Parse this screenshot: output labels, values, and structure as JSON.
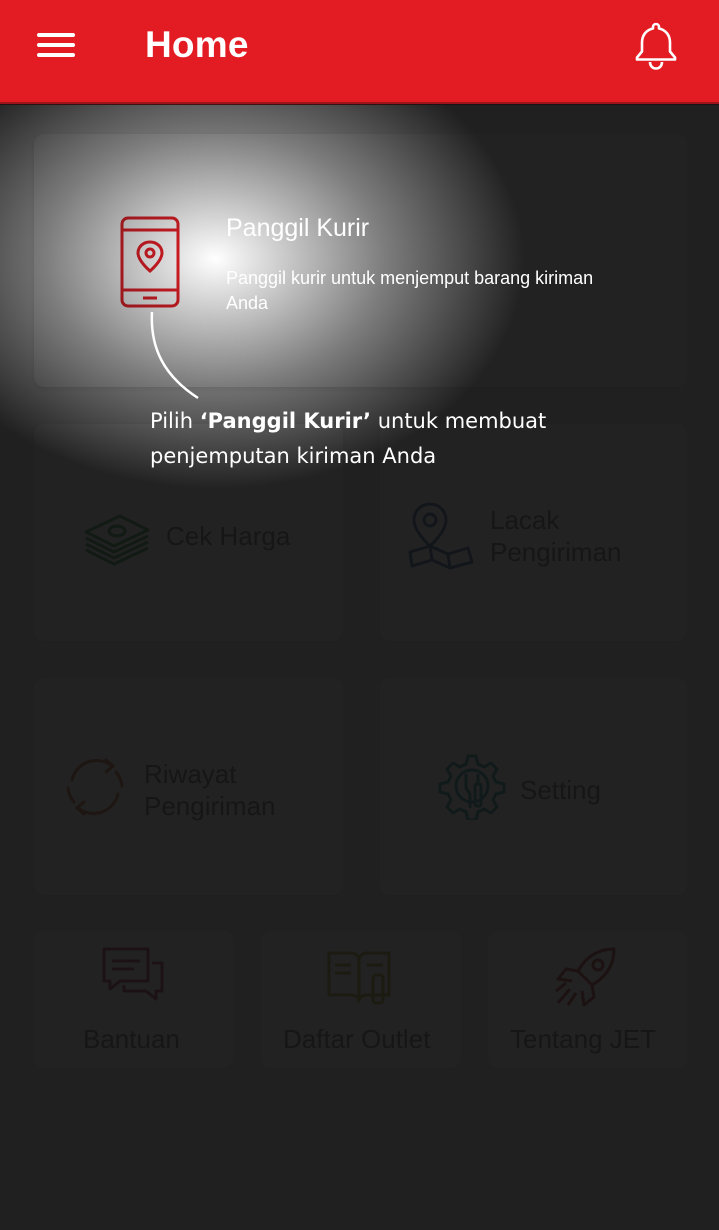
{
  "header": {
    "title": "Home",
    "menu_icon": "hamburger-menu-icon",
    "notification_icon": "bell-icon",
    "color": "#e31b23"
  },
  "featured": {
    "title": "Panggil Kurir",
    "description": "Panggil kurir untuk menjemput barang kiriman Anda",
    "icon": "phone-location-icon",
    "icon_color": "#e31b23"
  },
  "tooltip": {
    "prefix": "Pilih ",
    "emphasis": "‘Panggil Kurir’",
    "suffix": " untuk membuat penjemputan kiriman Anda"
  },
  "menu": {
    "cek_harga": {
      "label": "Cek Harga",
      "icon": "money-stack-icon",
      "color": "#1f8a3e"
    },
    "lacak_pengiriman": {
      "label_line1": "Lacak",
      "label_line2": "Pengiriman",
      "icon": "map-pin-icon",
      "color": "#1c5e9e"
    },
    "riwayat_pengiriman": {
      "label_line1": "Riwayat",
      "label_line2": "Pengiriman",
      "icon": "refresh-cycle-icon",
      "color": "#c0561b"
    },
    "setting": {
      "label": "Setting",
      "icon": "gear-tools-icon",
      "color": "#138aa0"
    },
    "bantuan": {
      "label": "Bantuan",
      "icon": "chat-bubbles-icon",
      "color": "#b21a5c"
    },
    "daftar_outlet": {
      "label": "Daftar Outlet",
      "icon": "book-list-icon",
      "color": "#b39b12"
    },
    "tentang_jet": {
      "label": "Tentang JET",
      "icon": "rocket-icon",
      "color": "#b8191f"
    }
  }
}
